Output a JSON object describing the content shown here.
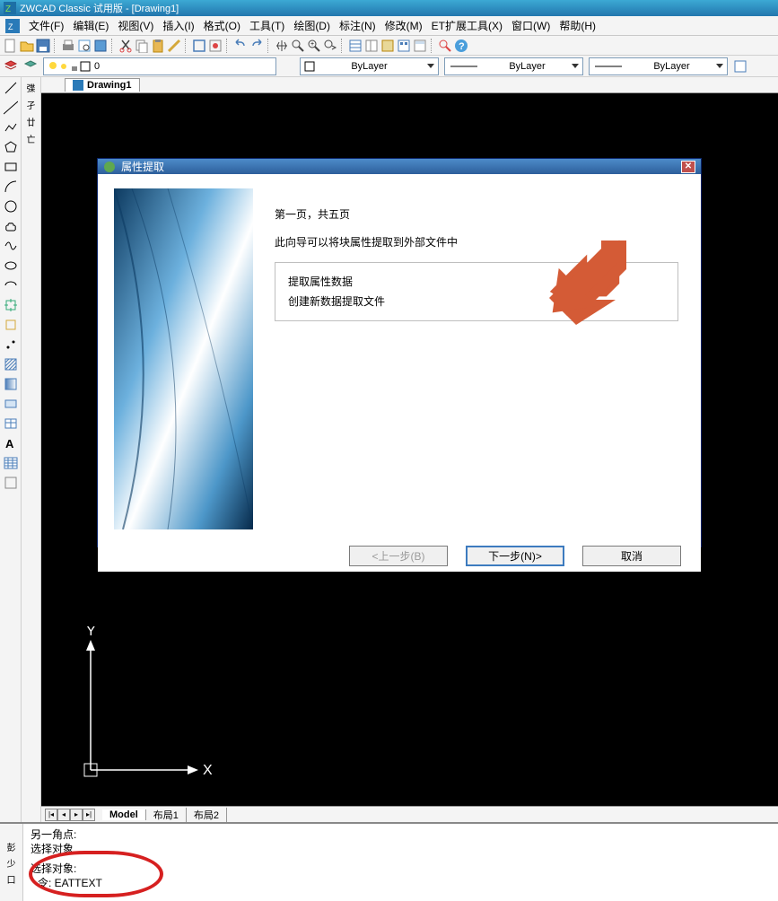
{
  "title": "ZWCAD Classic 试用版 - [Drawing1]",
  "menu": [
    "文件(F)",
    "编辑(E)",
    "视图(V)",
    "插入(I)",
    "格式(O)",
    "工具(T)",
    "绘图(D)",
    "标注(N)",
    "修改(M)",
    "ET扩展工具(X)",
    "窗口(W)",
    "帮助(H)"
  ],
  "layer": {
    "current": "0",
    "byLayer1": "ByLayer",
    "byLayer2": "ByLayer",
    "byLayer3": "ByLayer"
  },
  "docTab": "Drawing1",
  "layoutTabs": [
    "Model",
    "布局1",
    "布局2"
  ],
  "ucs": {
    "x": "X",
    "y": "Y"
  },
  "cmd": {
    "l1": "另一角点:",
    "l2": "选择对象",
    "l3": "选择对象:",
    "l4": "令: EATTEXT"
  },
  "dialog": {
    "title": "属性提取",
    "page": "第一页，共五页",
    "desc": "此向导可以将块属性提取到外部文件中",
    "opt1": "提取属性数据",
    "opt2": "创建新数据提取文件",
    "btnPrev": "<上一步(B)",
    "btnNext": "下一步(N)>",
    "btnCancel": "取消"
  }
}
